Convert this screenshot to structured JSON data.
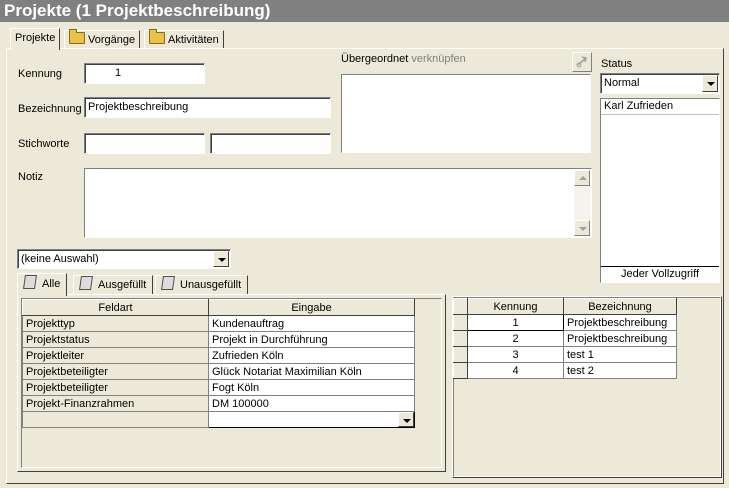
{
  "window": {
    "title": "Projekte (1 Projektbeschreibung)"
  },
  "tabs": [
    {
      "label": "Projekte"
    },
    {
      "label": "Vorgänge"
    },
    {
      "label": "Aktivitäten"
    }
  ],
  "form": {
    "kennung_label": "Kennung",
    "kennung_value": "1",
    "bezeichnung_label": "Bezeichnung",
    "bezeichnung_value": "Projektbeschreibung",
    "stichworte_label": "Stichworte",
    "stichworte_value1": "",
    "stichworte_value2": "",
    "notiz_label": "Notiz",
    "notiz_value": "",
    "uebergeordnet_label": "Übergeordnet",
    "verknuepfen_label": "verknüpfen",
    "status_label": "Status",
    "status_value": "Normal",
    "persons": [
      "Karl Zufrieden"
    ],
    "access_label": "Jeder Vollzugriff",
    "selection_value": "(keine Auswahl)"
  },
  "subtabs": [
    {
      "label": "Alle"
    },
    {
      "label": "Ausgefüllt"
    },
    {
      "label": "Unausgefüllt"
    }
  ],
  "fields_table": {
    "headers": [
      "Feldart",
      "Eingabe"
    ],
    "rows": [
      [
        "Projekttyp",
        "Kundenauftrag"
      ],
      [
        "Projektstatus",
        "Projekt in Durchführung"
      ],
      [
        "Projektleiter",
        "Zufrieden  Köln"
      ],
      [
        "Projektbeteiligter",
        "Glück Notariat Maximilian Köln"
      ],
      [
        "Projektbeteiligter",
        "Fogt  Köln"
      ],
      [
        "Projekt-Finanzrahmen",
        "DM 100000"
      ]
    ]
  },
  "projects_table": {
    "headers": [
      "Kennung",
      "Bezeichnung"
    ],
    "rows": [
      [
        "1",
        "Projektbeschreibung"
      ],
      [
        "2",
        "Projektbeschreibung"
      ],
      [
        "3",
        "test 1"
      ],
      [
        "4",
        "test 2"
      ]
    ]
  }
}
